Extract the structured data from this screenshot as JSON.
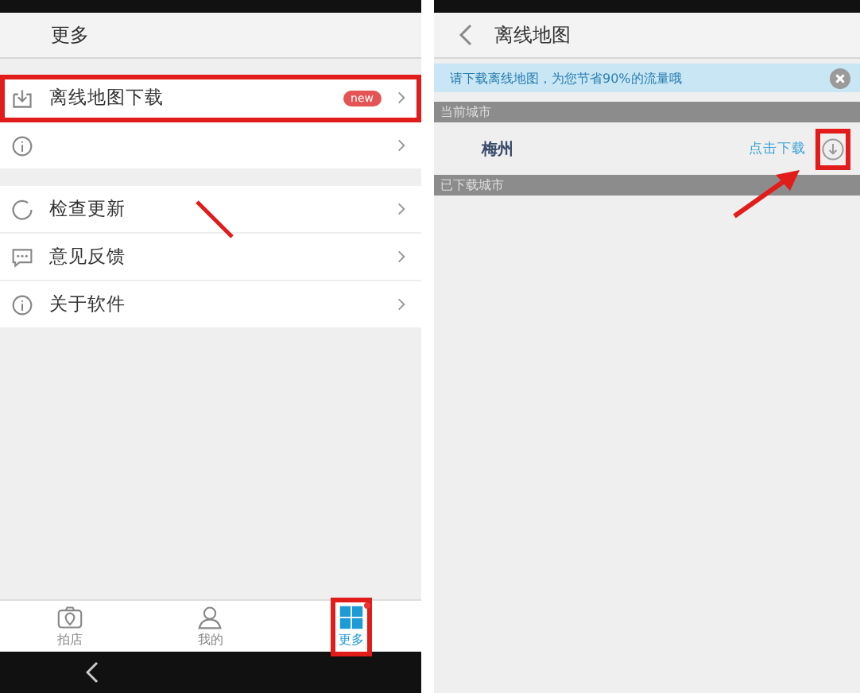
{
  "more_screen": {
    "title": "更多",
    "groups": [
      {
        "items": [
          {
            "kind": "download",
            "label": "离线地图下载",
            "badge": "new",
            "highlighted": true
          },
          {
            "kind": "info",
            "highlighted": false
          }
        ]
      },
      {
        "items": [
          {
            "kind": "refresh",
            "label": "检查更新",
            "highlighted": false
          },
          {
            "kind": "chat",
            "label": "意见反馈",
            "highlighted": false
          },
          {
            "kind": "info",
            "label": "关于软件",
            "highlighted": false
          }
        ]
      }
    ],
    "tabs": [
      {
        "kind": "camera",
        "label": "拍店",
        "selected": false,
        "highlighted": false,
        "dot": false
      },
      {
        "kind": "person",
        "label": "我的",
        "selected": false,
        "highlighted": false,
        "dot": false
      },
      {
        "kind": "grid",
        "label": "更多",
        "selected": true,
        "highlighted": true,
        "dot": true
      }
    ]
  },
  "offline_map_screen": {
    "title": "离线地图",
    "banner": "请下载离线地图，为您节省90%的流量哦",
    "sections": [
      {
        "header": "当前城市",
        "rows": [
          {
            "city": "梅州",
            "action": "点击下载",
            "highlighted": true
          }
        ]
      },
      {
        "header": "已下载城市"
      }
    ]
  }
}
